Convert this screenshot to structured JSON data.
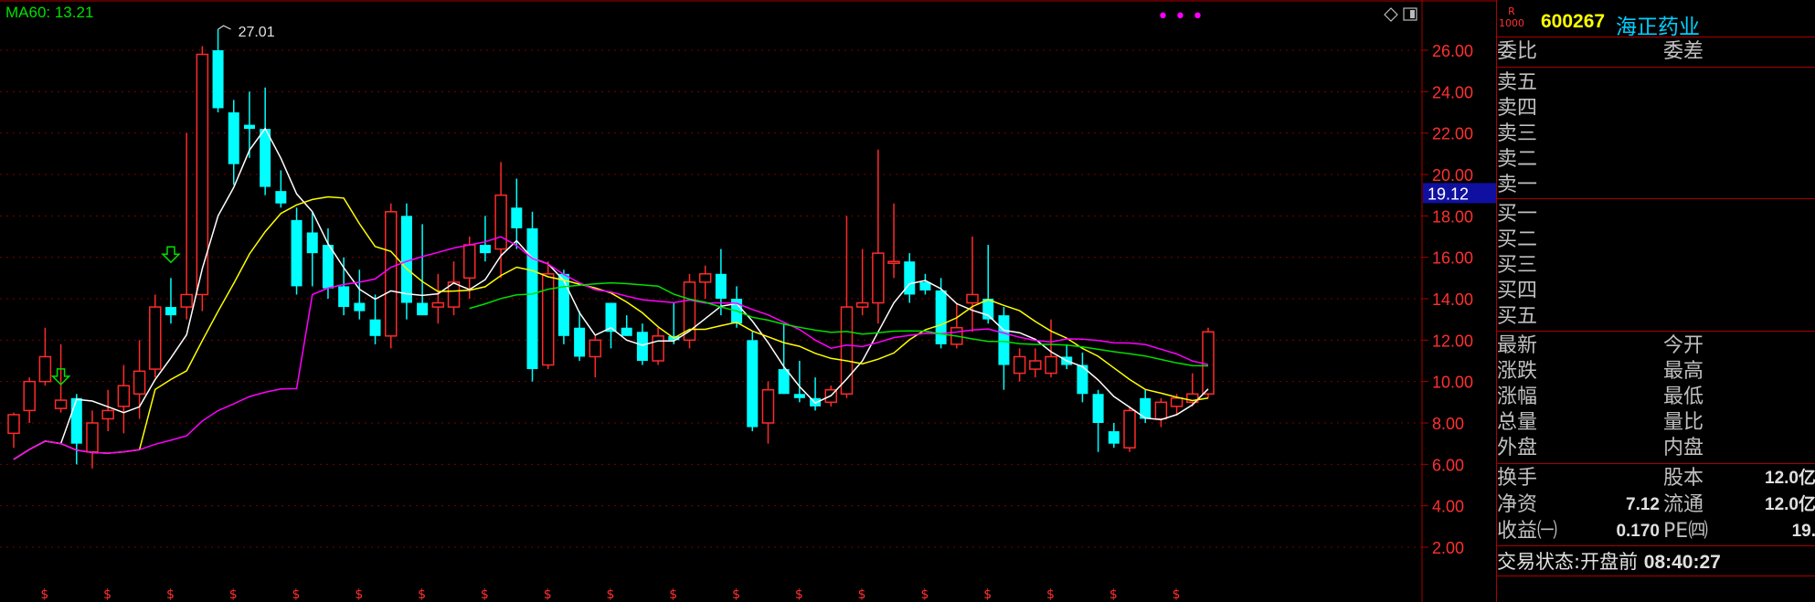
{
  "indicator": {
    "ma60_label": "MA60: 13.21"
  },
  "chart": {
    "high_marker": "27.01",
    "current_price_tag": "19.12",
    "y_ticks": [
      "26.00",
      "24.00",
      "22.00",
      "20.00",
      "18.00",
      "16.00",
      "14.00",
      "12.00",
      "10.00",
      "8.00",
      "6.00",
      "4.00",
      "2.00"
    ],
    "colors": {
      "up": "#ff2a2a",
      "down": "#00ffff",
      "ma5": "#ffffff",
      "ma10": "#ffff00",
      "ma20": "#ff00ff",
      "ma60": "#00e000",
      "grid": "#7a0000"
    }
  },
  "chart_data": {
    "type": "candlestick",
    "ylim": [
      0,
      28
    ],
    "candles": [
      {
        "o": 7.5,
        "h": 8.5,
        "l": 6.8,
        "c": 8.4
      },
      {
        "o": 8.6,
        "h": 10.2,
        "l": 8.0,
        "c": 10.0
      },
      {
        "o": 10.0,
        "h": 12.6,
        "l": 9.8,
        "c": 11.2
      },
      {
        "o": 8.7,
        "h": 11.8,
        "l": 8.5,
        "c": 9.1
      },
      {
        "o": 9.2,
        "h": 9.4,
        "l": 6.0,
        "c": 7.0
      },
      {
        "o": 6.6,
        "h": 8.6,
        "l": 5.8,
        "c": 8.0
      },
      {
        "o": 8.2,
        "h": 9.6,
        "l": 7.6,
        "c": 8.6
      },
      {
        "o": 8.8,
        "h": 10.8,
        "l": 7.5,
        "c": 9.8
      },
      {
        "o": 9.4,
        "h": 12.0,
        "l": 8.2,
        "c": 10.5
      },
      {
        "o": 10.6,
        "h": 14.2,
        "l": 10.2,
        "c": 13.6
      },
      {
        "o": 13.6,
        "h": 15.0,
        "l": 12.8,
        "c": 13.2
      },
      {
        "o": 13.6,
        "h": 22.0,
        "l": 13.0,
        "c": 14.2
      },
      {
        "o": 14.2,
        "h": 26.2,
        "l": 13.4,
        "c": 25.8
      },
      {
        "o": 26.0,
        "h": 27.01,
        "l": 23.0,
        "c": 23.2
      },
      {
        "o": 23.0,
        "h": 23.6,
        "l": 19.5,
        "c": 20.5
      },
      {
        "o": 22.4,
        "h": 24.0,
        "l": 20.8,
        "c": 22.2
      },
      {
        "o": 22.2,
        "h": 24.2,
        "l": 19.0,
        "c": 19.4
      },
      {
        "o": 19.2,
        "h": 20.2,
        "l": 18.4,
        "c": 18.6
      },
      {
        "o": 17.8,
        "h": 18.4,
        "l": 14.2,
        "c": 14.6
      },
      {
        "o": 17.2,
        "h": 18.2,
        "l": 14.6,
        "c": 16.2
      },
      {
        "o": 16.6,
        "h": 17.4,
        "l": 14.0,
        "c": 14.5
      },
      {
        "o": 14.6,
        "h": 16.0,
        "l": 13.2,
        "c": 13.6
      },
      {
        "o": 13.8,
        "h": 15.4,
        "l": 13.0,
        "c": 13.4
      },
      {
        "o": 13.0,
        "h": 14.2,
        "l": 11.8,
        "c": 12.2
      },
      {
        "o": 12.2,
        "h": 18.6,
        "l": 11.6,
        "c": 18.2
      },
      {
        "o": 18.0,
        "h": 18.6,
        "l": 13.0,
        "c": 13.8
      },
      {
        "o": 13.8,
        "h": 17.6,
        "l": 13.2,
        "c": 13.2
      },
      {
        "o": 13.6,
        "h": 15.2,
        "l": 12.8,
        "c": 13.8
      },
      {
        "o": 13.6,
        "h": 15.8,
        "l": 13.2,
        "c": 14.8
      },
      {
        "o": 15.0,
        "h": 17.0,
        "l": 14.0,
        "c": 16.6
      },
      {
        "o": 16.6,
        "h": 18.0,
        "l": 15.8,
        "c": 16.2
      },
      {
        "o": 16.4,
        "h": 20.6,
        "l": 15.0,
        "c": 19.0
      },
      {
        "o": 18.4,
        "h": 19.8,
        "l": 16.4,
        "c": 17.4
      },
      {
        "o": 17.4,
        "h": 18.2,
        "l": 10.0,
        "c": 10.6
      },
      {
        "o": 10.8,
        "h": 15.8,
        "l": 10.6,
        "c": 15.2
      },
      {
        "o": 15.2,
        "h": 15.4,
        "l": 11.8,
        "c": 12.2
      },
      {
        "o": 12.6,
        "h": 13.4,
        "l": 11.0,
        "c": 11.2
      },
      {
        "o": 11.2,
        "h": 12.2,
        "l": 10.2,
        "c": 12.0
      },
      {
        "o": 13.8,
        "h": 13.8,
        "l": 11.6,
        "c": 12.4
      },
      {
        "o": 12.6,
        "h": 13.2,
        "l": 12.2,
        "c": 12.2
      },
      {
        "o": 12.4,
        "h": 12.8,
        "l": 10.8,
        "c": 11.0
      },
      {
        "o": 11.0,
        "h": 12.6,
        "l": 10.8,
        "c": 12.2
      },
      {
        "o": 12.2,
        "h": 13.8,
        "l": 11.8,
        "c": 12.0
      },
      {
        "o": 12.0,
        "h": 15.2,
        "l": 11.6,
        "c": 14.8
      },
      {
        "o": 14.8,
        "h": 15.6,
        "l": 14.0,
        "c": 15.2
      },
      {
        "o": 15.2,
        "h": 16.4,
        "l": 13.2,
        "c": 14.0
      },
      {
        "o": 14.0,
        "h": 14.6,
        "l": 12.6,
        "c": 12.8
      },
      {
        "o": 12.0,
        "h": 12.4,
        "l": 7.6,
        "c": 7.8
      },
      {
        "o": 8.0,
        "h": 10.0,
        "l": 7.0,
        "c": 9.6
      },
      {
        "o": 10.6,
        "h": 12.8,
        "l": 9.4,
        "c": 9.4
      },
      {
        "o": 9.4,
        "h": 11.0,
        "l": 9.0,
        "c": 9.2
      },
      {
        "o": 9.2,
        "h": 10.2,
        "l": 8.6,
        "c": 8.8
      },
      {
        "o": 9.0,
        "h": 9.8,
        "l": 8.8,
        "c": 9.6
      },
      {
        "o": 9.4,
        "h": 18.0,
        "l": 9.2,
        "c": 13.6
      },
      {
        "o": 13.6,
        "h": 16.4,
        "l": 13.2,
        "c": 13.8
      },
      {
        "o": 13.8,
        "h": 21.2,
        "l": 12.8,
        "c": 16.2
      },
      {
        "o": 15.8,
        "h": 18.6,
        "l": 15.0,
        "c": 15.8
      },
      {
        "o": 15.8,
        "h": 16.2,
        "l": 13.8,
        "c": 14.2
      },
      {
        "o": 14.8,
        "h": 15.2,
        "l": 14.2,
        "c": 14.4
      },
      {
        "o": 14.4,
        "h": 15.0,
        "l": 11.6,
        "c": 11.8
      },
      {
        "o": 11.8,
        "h": 13.8,
        "l": 11.6,
        "c": 12.6
      },
      {
        "o": 13.8,
        "h": 17.0,
        "l": 12.4,
        "c": 14.2
      },
      {
        "o": 14.0,
        "h": 16.6,
        "l": 12.8,
        "c": 13.0
      },
      {
        "o": 13.2,
        "h": 13.6,
        "l": 9.6,
        "c": 10.8
      },
      {
        "o": 10.4,
        "h": 11.6,
        "l": 10.0,
        "c": 11.2
      },
      {
        "o": 10.6,
        "h": 11.6,
        "l": 10.2,
        "c": 11.0
      },
      {
        "o": 10.4,
        "h": 13.0,
        "l": 10.2,
        "c": 11.2
      },
      {
        "o": 11.2,
        "h": 11.8,
        "l": 10.6,
        "c": 10.8
      },
      {
        "o": 10.8,
        "h": 11.4,
        "l": 9.0,
        "c": 9.4
      },
      {
        "o": 9.4,
        "h": 9.6,
        "l": 6.6,
        "c": 8.0
      },
      {
        "o": 7.6,
        "h": 8.0,
        "l": 6.8,
        "c": 7.0
      },
      {
        "o": 6.8,
        "h": 8.8,
        "l": 6.6,
        "c": 8.6
      },
      {
        "o": 9.2,
        "h": 9.6,
        "l": 8.0,
        "c": 8.2
      },
      {
        "o": 8.2,
        "h": 9.2,
        "l": 7.8,
        "c": 9.0
      },
      {
        "o": 8.8,
        "h": 9.4,
        "l": 8.4,
        "c": 9.2
      },
      {
        "o": 9.0,
        "h": 10.4,
        "l": 8.8,
        "c": 9.4
      },
      {
        "o": 9.4,
        "h": 12.6,
        "l": 9.2,
        "c": 12.4
      }
    ]
  },
  "panel": {
    "badge_top": "R",
    "badge_bottom": "1000",
    "code": "600267",
    "name": "海正药业",
    "weibi_label": "委比",
    "weicha_label": "委差",
    "sells": [
      "卖五",
      "卖四",
      "卖三",
      "卖二",
      "卖一"
    ],
    "buys": [
      "买一",
      "买二",
      "买三",
      "买四",
      "买五"
    ],
    "quote_rows": [
      {
        "l1": "最新",
        "l2": "今开"
      },
      {
        "l1": "涨跌",
        "l2": "最高"
      },
      {
        "l1": "涨幅",
        "l2": "最低"
      },
      {
        "l1": "总量",
        "l2": "量比"
      },
      {
        "l1": "外盘",
        "l2": "内盘"
      }
    ],
    "fund_rows": [
      {
        "l1": "换手",
        "v1": "",
        "l2": "股本",
        "v2": "12.0亿"
      },
      {
        "l1": "净资",
        "v1": "7.12",
        "l2": "流通",
        "v2": "12.0亿"
      },
      {
        "l1": "收益㈠",
        "v1": "0.170",
        "l2": "PE㈣",
        "v2": "19."
      }
    ],
    "status_label": "交易状态:",
    "status_value": "开盘前",
    "status_time": "08:40:27"
  }
}
